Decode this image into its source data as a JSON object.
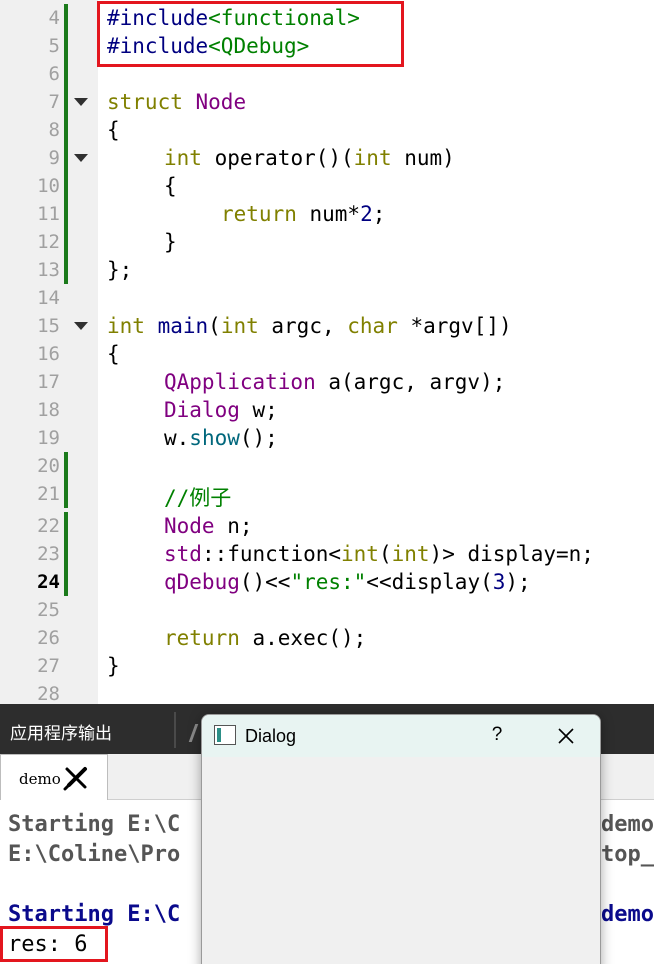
{
  "editor": {
    "current_line": "24",
    "lines": [
      {
        "num": "4"
      },
      {
        "num": "5"
      },
      {
        "num": "6"
      },
      {
        "num": "7"
      },
      {
        "num": "8"
      },
      {
        "num": "9"
      },
      {
        "num": "10"
      },
      {
        "num": "11"
      },
      {
        "num": "12"
      },
      {
        "num": "13"
      },
      {
        "num": "14"
      },
      {
        "num": "15"
      },
      {
        "num": "16"
      },
      {
        "num": "17"
      },
      {
        "num": "18"
      },
      {
        "num": "19"
      },
      {
        "num": "20"
      },
      {
        "num": "21"
      },
      {
        "num": "22"
      },
      {
        "num": "23"
      },
      {
        "num": "24"
      },
      {
        "num": "25"
      },
      {
        "num": "26"
      },
      {
        "num": "27"
      },
      {
        "num": "28"
      }
    ],
    "code": {
      "l4_pp": "#include",
      "l4_inc": "<functional>",
      "l5_pp": "#include",
      "l5_inc": "<QDebug>",
      "l7_kw": "struct",
      "l7_name": "Node",
      "l8": "{",
      "l9_kw": "int",
      "l9_mid": " operator()(",
      "l9_kw2": "int",
      "l9_end": " num)",
      "l10": "{",
      "l11_kw": "return",
      "l11_mid": " num*",
      "l11_num": "2",
      "l11_end": ";",
      "l12": "}",
      "l13": "};",
      "l15_kw": "int",
      "l15_fn": " main",
      "l15_p": "(",
      "l15_kw2": "int",
      "l15_mid": " argc, ",
      "l15_kw3": "char",
      "l15_end": " *argv[])",
      "l16": "{",
      "l17_cls": "QApplication",
      "l17_end": " a(argc, argv);",
      "l18_cls": "Dialog",
      "l18_end": " w;",
      "l19_obj": "w.",
      "l19_call": "show",
      "l19_end": "();",
      "l21_cmt": "//例子",
      "l22_cls": "Node",
      "l22_end": " n;",
      "l23_ns": "std",
      "l23_a": "::function<",
      "l23_kw": "int",
      "l23_b": "(",
      "l23_kw2": "int",
      "l23_c": ")> display=n;",
      "l24_fn": "qDebug",
      "l24_a": "()<<",
      "l24_str": "\"res:\"",
      "l24_b": "<<display(",
      "l24_num": "3",
      "l24_c": ");",
      "l26_kw": "return",
      "l26_end": " a.exec();",
      "l27": "}"
    }
  },
  "output_pane": {
    "title": "应用程序输出",
    "tab_label": "demo",
    "lines": [
      "Starting E:\\C",
      "E:\\Coline\\Pro",
      "Starting E:\\C",
      "res: 6"
    ],
    "lines_right": [
      "demo",
      "top_",
      "demo"
    ]
  },
  "dialog": {
    "title": "Dialog",
    "help": "?"
  },
  "colors": {
    "highlight_box": "#e3161e",
    "change_bar": "#1b7a1b",
    "keyword_type": "#808000",
    "class_name": "#800080",
    "string": "#008000"
  }
}
